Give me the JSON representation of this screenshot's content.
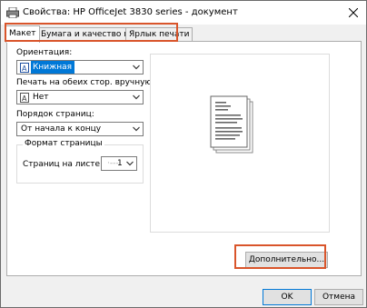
{
  "window": {
    "title": "Свойства: HP OfficeJet 3830 series - документ"
  },
  "tabs": [
    {
      "label": "Макет"
    },
    {
      "label": "Бумага и качество печати"
    },
    {
      "label": "Ярлык печати"
    }
  ],
  "orientation": {
    "label": "Ориентация:",
    "value": "Книжная"
  },
  "duplex": {
    "label": "Печать на обеих стор. вручную:",
    "value": "Нет"
  },
  "page_order": {
    "label": "Порядок страниц:",
    "value": "От начала к концу"
  },
  "page_format": {
    "group_title": "Формат страницы",
    "pages_per_sheet_label": "Страниц на листе",
    "pages_per_sheet_value": "1"
  },
  "buttons": {
    "advanced": "Дополнительно...",
    "ok": "OK",
    "cancel": "Отмена"
  },
  "colors": {
    "highlight": "#d9552b",
    "selection": "#0078d7"
  }
}
